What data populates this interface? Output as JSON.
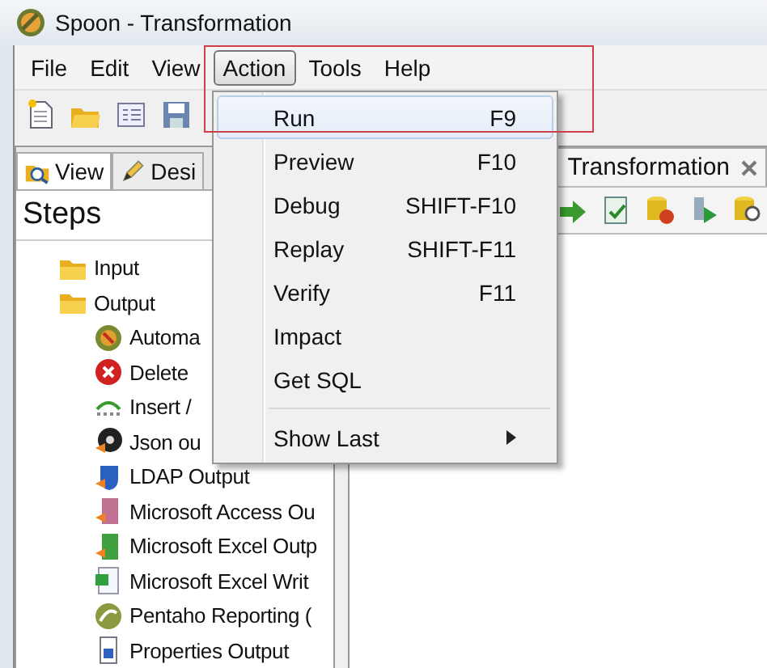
{
  "window": {
    "title": "Spoon - Transformation"
  },
  "menu_bar": [
    {
      "label": "File",
      "selected": false
    },
    {
      "label": "Edit",
      "selected": false
    },
    {
      "label": "View",
      "selected": false
    },
    {
      "label": "Action",
      "selected": true
    },
    {
      "label": "Tools",
      "selected": false
    },
    {
      "label": "Help",
      "selected": false
    }
  ],
  "left_panel": {
    "tabs": [
      {
        "label": "View",
        "selected": true
      },
      {
        "label": "Desi",
        "selected": false
      }
    ],
    "heading": "Steps",
    "tree": [
      {
        "label": "Input"
      },
      {
        "label": "Output",
        "children": [
          {
            "label": "Automa"
          },
          {
            "label": "Delete"
          },
          {
            "label": "Insert /"
          },
          {
            "label": "Json ou"
          },
          {
            "label": "LDAP Output"
          },
          {
            "label": "Microsoft Access Ou"
          },
          {
            "label": "Microsoft Excel Outp"
          },
          {
            "label": "Microsoft Excel Writ"
          },
          {
            "label": "Pentaho Reporting ("
          },
          {
            "label": "Properties Output"
          }
        ]
      }
    ]
  },
  "editor": {
    "tab": {
      "label": "Transformation"
    }
  },
  "action_menu": [
    {
      "kind": "item",
      "label": "Run",
      "shortcut": "F9",
      "selected": true
    },
    {
      "kind": "item",
      "label": "Preview",
      "shortcut": "F10",
      "selected": false
    },
    {
      "kind": "item",
      "label": "Debug",
      "shortcut": "SHIFT-F10",
      "selected": false
    },
    {
      "kind": "item",
      "label": "Replay",
      "shortcut": "SHIFT-F11",
      "selected": false
    },
    {
      "kind": "item",
      "label": "Verify",
      "shortcut": "F11",
      "selected": false
    },
    {
      "kind": "item",
      "label": "Impact",
      "selected": false
    },
    {
      "kind": "item",
      "label": "Get SQL",
      "selected": false
    },
    {
      "kind": "separator"
    },
    {
      "kind": "submenu",
      "label": "Show Last",
      "selected": false
    }
  ]
}
